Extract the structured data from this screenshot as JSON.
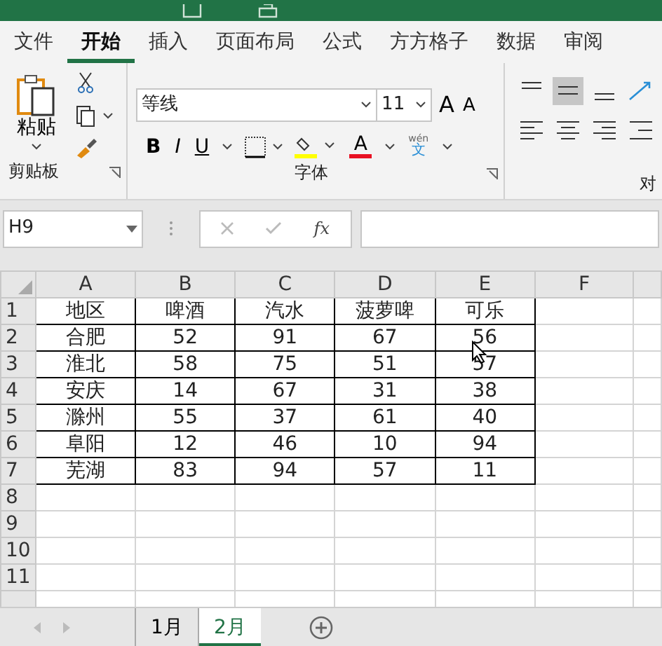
{
  "menu_tabs": [
    {
      "label": "文件",
      "selected": false
    },
    {
      "label": "开始",
      "selected": true
    },
    {
      "label": "插入",
      "selected": false
    },
    {
      "label": "页面布局",
      "selected": false
    },
    {
      "label": "公式",
      "selected": false
    },
    {
      "label": "方方格子",
      "selected": false
    },
    {
      "label": "数据",
      "selected": false
    },
    {
      "label": "审阅",
      "selected": false
    }
  ],
  "ribbon": {
    "clipboard": {
      "paste_label": "粘贴",
      "group_label": "剪贴板"
    },
    "font": {
      "font_name": "等线",
      "font_size": "11",
      "grow_glyph": "A",
      "shrink_glyph": "A",
      "bold_glyph": "B",
      "italic_glyph": "I",
      "underline_glyph": "U",
      "font_color_glyph": "A",
      "phonetic_top": "wén",
      "phonetic_bottom": "文",
      "group_label": "字体"
    },
    "alignment": {
      "group_label": "对"
    }
  },
  "name_box": "H9",
  "formula_icon": "fx",
  "sheet": {
    "columns": [
      "A",
      "B",
      "C",
      "D",
      "E",
      "F"
    ],
    "rows": [
      {
        "number": "1",
        "cells": [
          "地区",
          "啤酒",
          "汽水",
          "菠萝啤",
          "可乐",
          ""
        ]
      },
      {
        "number": "2",
        "cells": [
          "合肥",
          "52",
          "91",
          "67",
          "56",
          ""
        ]
      },
      {
        "number": "3",
        "cells": [
          "淮北",
          "58",
          "75",
          "51",
          "57",
          ""
        ]
      },
      {
        "number": "4",
        "cells": [
          "安庆",
          "14",
          "67",
          "31",
          "38",
          ""
        ]
      },
      {
        "number": "5",
        "cells": [
          "滁州",
          "55",
          "37",
          "61",
          "40",
          ""
        ]
      },
      {
        "number": "6",
        "cells": [
          "阜阳",
          "12",
          "46",
          "10",
          "94",
          ""
        ]
      },
      {
        "number": "7",
        "cells": [
          "芜湖",
          "83",
          "94",
          "57",
          "11",
          ""
        ]
      },
      {
        "number": "8",
        "cells": [
          "",
          "",
          "",
          "",
          "",
          ""
        ]
      },
      {
        "number": "9",
        "cells": [
          "",
          "",
          "",
          "",
          "",
          ""
        ]
      },
      {
        "number": "10",
        "cells": [
          "",
          "",
          "",
          "",
          "",
          ""
        ]
      },
      {
        "number": "11",
        "cells": [
          "",
          "",
          "",
          "",
          "",
          ""
        ]
      }
    ]
  },
  "sheet_tabs": [
    {
      "label": "1月",
      "selected": false
    },
    {
      "label": "2月",
      "selected": true
    }
  ]
}
